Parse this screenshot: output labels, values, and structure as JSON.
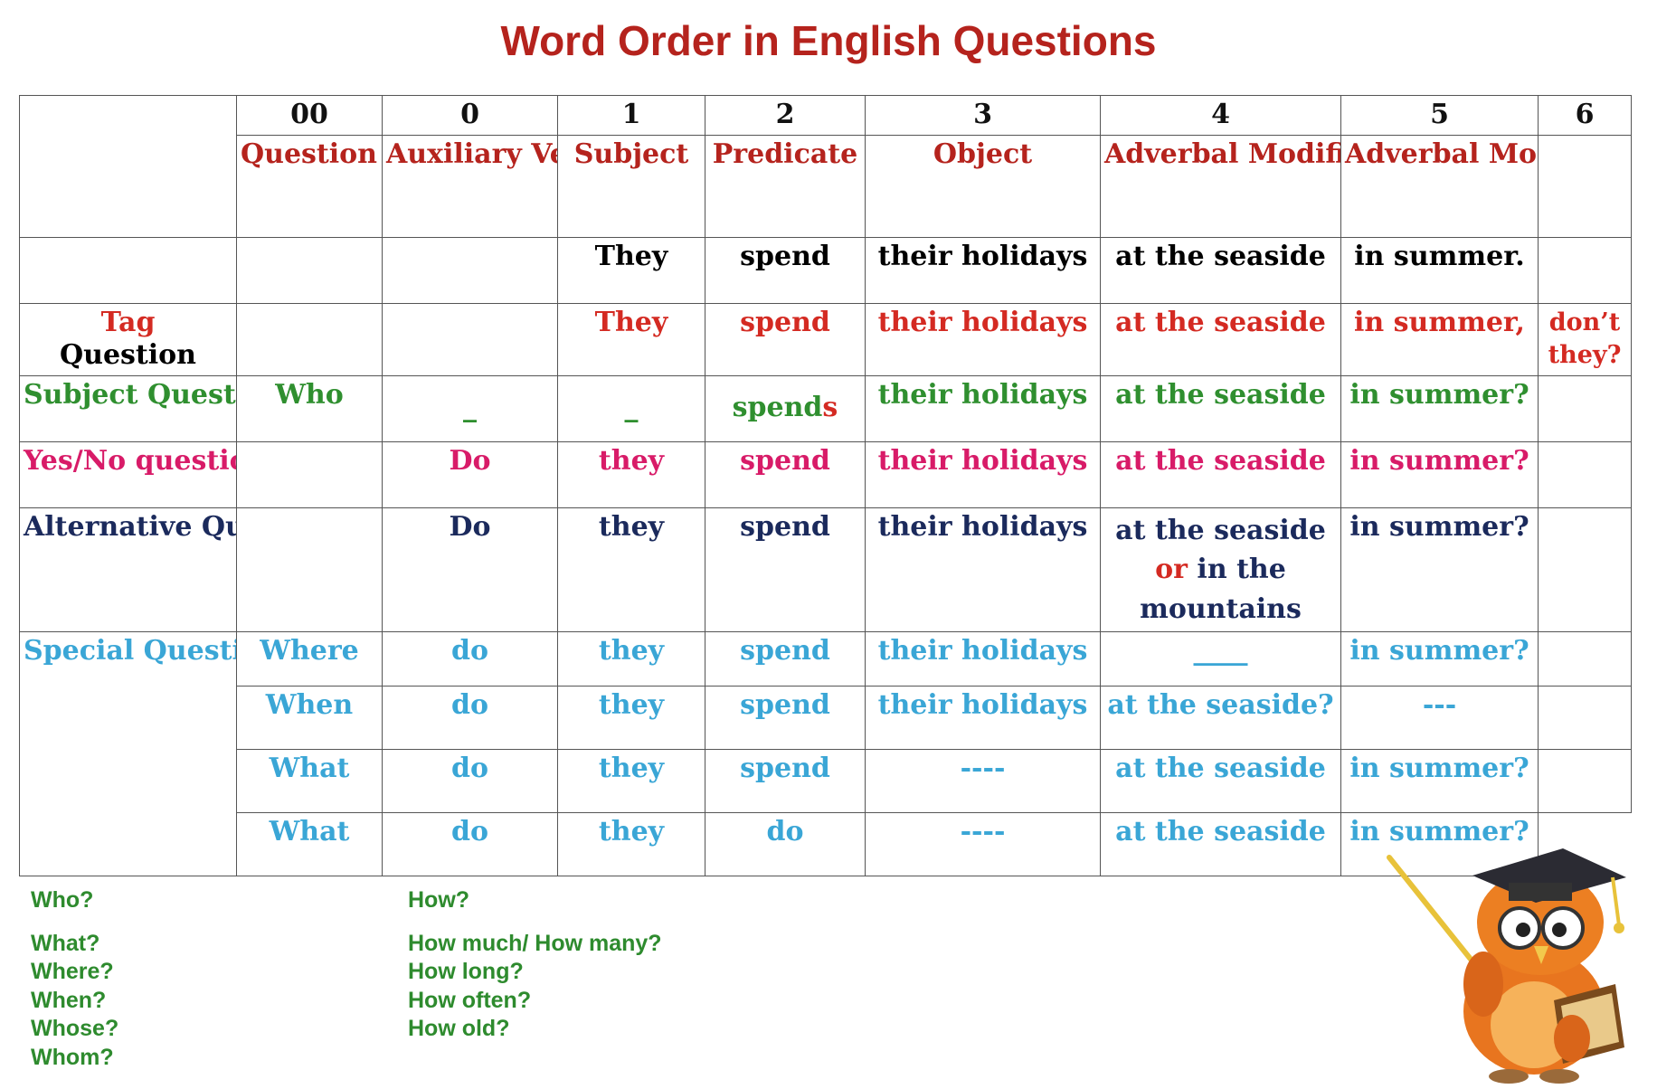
{
  "title": "Word Order in English Questions",
  "header": {
    "numbers": [
      "00",
      "0",
      "1",
      "2",
      "3",
      "4",
      "5",
      "6"
    ],
    "names": [
      "Question Word",
      "Auxiliary Verb",
      "Subject",
      "Predicate",
      "Object",
      "Adverbal Modifier of Place",
      "Adverbal Modifier of Time",
      ""
    ]
  },
  "rows": {
    "statement": {
      "subject": "They",
      "predicate": "spend",
      "object": "their holidays",
      "place": "at the seaside",
      "time": "in summer."
    },
    "tag": {
      "label_a": "Tag",
      "label_b": "Question",
      "subject": "They",
      "predicate": "spend",
      "object": "their holidays",
      "place": "at the seaside",
      "time": "in summer,",
      "tag_a": "don’t",
      "tag_b": "they?"
    },
    "subject_q": {
      "label": "Subject Question",
      "qword": "Who",
      "aux": "_",
      "subject": "_",
      "predicate_stem": "spend",
      "predicate_ending": "s",
      "object": "their holidays",
      "place": "at the seaside",
      "time": "in summer?"
    },
    "yes_no": {
      "label": "Yes/No question",
      "aux": "Do",
      "subject": "they",
      "predicate": "spend",
      "object": "their holidays",
      "place": "at the seaside",
      "time": "in summer?"
    },
    "alternative": {
      "label": "Alternative Question (OR Question)",
      "aux": "Do",
      "subject": "they",
      "predicate": "spend",
      "object": "their holidays",
      "place_a": "at the seaside",
      "place_or": "or",
      "place_b": "in the",
      "place_c": "mountains",
      "time": "in summer?"
    },
    "special_label": "Special Question",
    "special": [
      {
        "qword": "Where",
        "aux": "do",
        "subject": "they",
        "predicate": "spend",
        "object": "their holidays",
        "place": "____",
        "time": "in summer?"
      },
      {
        "qword": "When",
        "aux": "do",
        "subject": "they",
        "predicate": "spend",
        "object": "their holidays",
        "place": "at the seaside?",
        "time": "---"
      },
      {
        "qword": "What",
        "aux": "do",
        "subject": "they",
        "predicate": "spend",
        "object": "----",
        "place": "at the seaside",
        "time": "in summer?"
      },
      {
        "qword": "What",
        "aux": "do",
        "subject": "they",
        "predicate": "do",
        "object": "----",
        "place": "at the seaside",
        "time": "in summer?"
      }
    ]
  },
  "question_words": {
    "left": [
      "Who?",
      "What?",
      "Where?",
      "When?",
      "Whose?",
      "Whom?"
    ],
    "right": [
      "How?",
      "How much/ How many?",
      "How long?",
      "How often?",
      "How old?"
    ]
  },
  "colors": {
    "title": "#b5231d",
    "tag": "#d42a22",
    "subject_question": "#2f8f2f",
    "yes_no": "#d81b68",
    "alternative": "#1b2a5c",
    "special": "#3aa6d6",
    "question_words": "#2e8b2e"
  },
  "mascot": "owl-professor-illustration"
}
